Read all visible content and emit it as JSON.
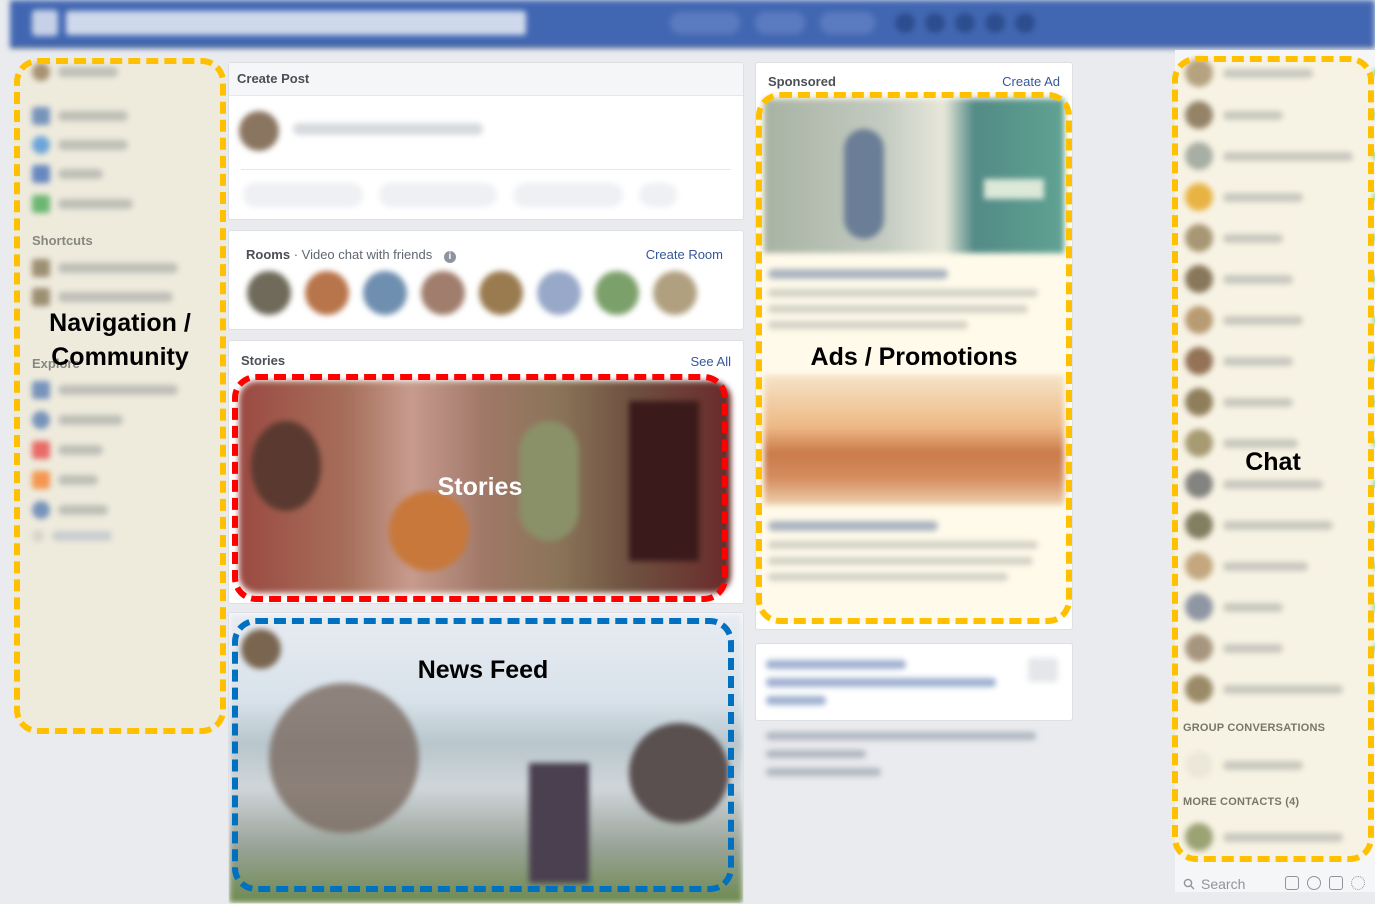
{
  "create_post": {
    "title": "Create Post"
  },
  "rooms": {
    "title": "Rooms",
    "subtitle": "Video chat with friends",
    "create_label": "Create Room"
  },
  "stories": {
    "title": "Stories",
    "see_all": "See All"
  },
  "sidebar": {
    "shortcuts_label": "Shortcuts",
    "explore_label": "Explore"
  },
  "sponsored": {
    "title": "Sponsored",
    "create_ad": "Create Ad"
  },
  "chat": {
    "group_conversations": "GROUP CONVERSATIONS",
    "more_contacts": "MORE CONTACTS (4)",
    "search_placeholder": "Search"
  },
  "overlays": {
    "navigation": "Navigation /\nCommunity",
    "stories": "Stories",
    "news_feed": "News Feed",
    "ads": "Ads / Promotions",
    "chat": "Chat"
  },
  "colors": {
    "facebook_blue": "#4267b2",
    "overlay_yellow": "#ffc000",
    "overlay_red": "#ff0000",
    "overlay_blue": "#0070c0",
    "link_blue": "#365899"
  },
  "icons": [
    "search-icon",
    "info-icon",
    "compose-icon",
    "contacts-icon",
    "video-icon",
    "gear-icon"
  ]
}
